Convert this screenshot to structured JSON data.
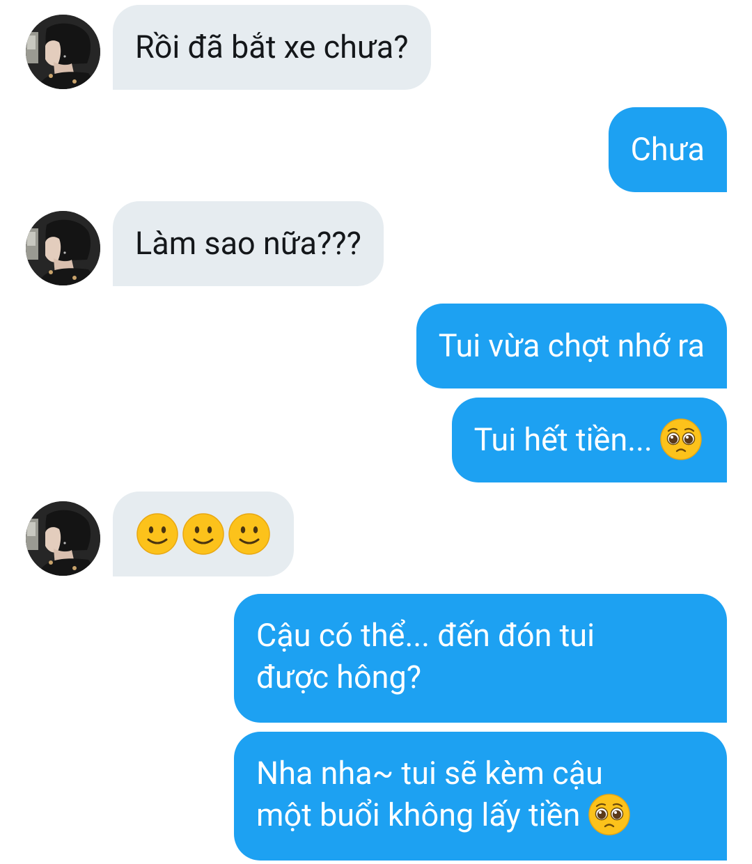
{
  "conversation": {
    "messages": [
      {
        "direction": "incoming",
        "text": "Rồi đã bắt xe chưa?"
      },
      {
        "direction": "outgoing",
        "text": "Chưa"
      },
      {
        "direction": "incoming",
        "text": "Làm sao nữa???"
      },
      {
        "direction": "outgoing",
        "text": "Tui vừa chợt nhớ ra"
      },
      {
        "direction": "outgoing",
        "text": "Tui hết tiền...",
        "emoji": "pleading-face"
      },
      {
        "direction": "incoming",
        "emoji": [
          "slightly-smiling-face",
          "slightly-smiling-face",
          "slightly-smiling-face"
        ]
      },
      {
        "direction": "outgoing",
        "lines": [
          "Cậu có thể... đến đón tui",
          "được hông?"
        ]
      },
      {
        "direction": "outgoing",
        "lines": [
          "Nha nha~ tui sẽ kèm cậu",
          "một buổi không lấy tiền"
        ],
        "emoji": "pleading-face"
      }
    ]
  },
  "colors": {
    "incoming_bubble": "#e6ecf0",
    "outgoing_bubble": "#1da1f2",
    "incoming_text": "#14171a",
    "outgoing_text": "#ffffff"
  }
}
